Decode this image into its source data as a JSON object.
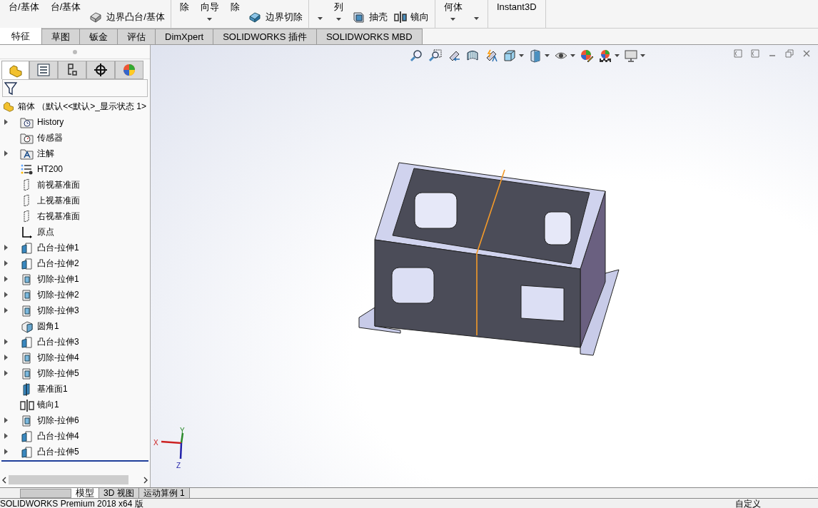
{
  "ribbon": {
    "groups": [
      {
        "items": [
          {
            "kind": "big",
            "label": "台/基体"
          },
          {
            "kind": "big",
            "label": "台/基体"
          },
          {
            "kind": "boss-tool",
            "label": "边界凸台/基体"
          }
        ]
      },
      {
        "items": [
          {
            "kind": "big",
            "label": "除"
          },
          {
            "kind": "bigcaret",
            "label": "向导"
          },
          {
            "kind": "big",
            "label": "除"
          },
          {
            "kind": "cut-tool",
            "label": "边界切除"
          }
        ]
      },
      {
        "items": [
          {
            "kind": "caret"
          },
          {
            "kind": "bigcaret",
            "label": "列"
          },
          {
            "kind": "shell-tool",
            "label": "抽壳"
          },
          {
            "kind": "mirror-tool",
            "label": "镜向"
          }
        ]
      },
      {
        "items": [
          {
            "kind": "bigcaret",
            "label": "何体"
          },
          {
            "kind": "caret"
          }
        ]
      },
      {
        "items": [
          {
            "kind": "big",
            "label": "Instant3D"
          }
        ]
      }
    ]
  },
  "tabs": [
    {
      "label": "特征",
      "selected": true
    },
    {
      "label": "草图",
      "selected": false
    },
    {
      "label": "钣金",
      "selected": false
    },
    {
      "label": "评估",
      "selected": false
    },
    {
      "label": "DimXpert",
      "selected": false
    },
    {
      "label": "SOLIDWORKS 插件",
      "selected": false
    },
    {
      "label": "SOLIDWORKS MBD",
      "selected": false
    }
  ],
  "panel_tabs": [
    {
      "kind": "feature",
      "selected": true
    },
    {
      "kind": "property",
      "selected": false
    },
    {
      "kind": "config",
      "selected": false
    },
    {
      "kind": "dimxpert",
      "selected": false
    },
    {
      "kind": "display",
      "selected": false
    }
  ],
  "tree": {
    "root": "箱体 （默认<<默认>_显示状态 1>",
    "items": [
      {
        "kind": "history",
        "label": "History",
        "expandable": true
      },
      {
        "kind": "sensor",
        "label": "传感器",
        "expandable": false
      },
      {
        "kind": "annotation",
        "label": "注解",
        "expandable": true
      },
      {
        "kind": "material",
        "label": "HT200",
        "expandable": false
      },
      {
        "kind": "plane",
        "label": "前视基准面",
        "expandable": false
      },
      {
        "kind": "plane",
        "label": "上视基准面",
        "expandable": false
      },
      {
        "kind": "plane",
        "label": "右视基准面",
        "expandable": false
      },
      {
        "kind": "origin",
        "label": "原点",
        "expandable": false
      },
      {
        "kind": "boss",
        "label": "凸台-拉伸1",
        "expandable": true
      },
      {
        "kind": "boss",
        "label": "凸台-拉伸2",
        "expandable": true
      },
      {
        "kind": "cut",
        "label": "切除-拉伸1",
        "expandable": true
      },
      {
        "kind": "cut",
        "label": "切除-拉伸2",
        "expandable": true
      },
      {
        "kind": "cut",
        "label": "切除-拉伸3",
        "expandable": true
      },
      {
        "kind": "fillet",
        "label": "圆角1",
        "expandable": false
      },
      {
        "kind": "boss",
        "label": "凸台-拉伸3",
        "expandable": true
      },
      {
        "kind": "cut",
        "label": "切除-拉伸4",
        "expandable": true
      },
      {
        "kind": "cut",
        "label": "切除-拉伸5",
        "expandable": true
      },
      {
        "kind": "refplane",
        "label": "基准面1",
        "expandable": false
      },
      {
        "kind": "mirror",
        "label": "镜向1",
        "expandable": false
      },
      {
        "kind": "cut",
        "label": "切除-拉伸6",
        "expandable": true
      },
      {
        "kind": "boss",
        "label": "凸台-拉伸4",
        "expandable": true
      },
      {
        "kind": "boss",
        "label": "凸台-拉伸5",
        "expandable": true
      }
    ]
  },
  "view_toolbar": [
    {
      "kind": "zoom-fit",
      "caret": false
    },
    {
      "kind": "zoom-area",
      "caret": false
    },
    {
      "kind": "previous",
      "caret": false
    },
    {
      "kind": "section",
      "caret": false
    },
    {
      "kind": "dynamic",
      "caret": false
    },
    {
      "kind": "orientation",
      "caret": true
    },
    {
      "kind": "display-style",
      "caret": true
    },
    {
      "kind": "hide-show",
      "caret": true
    },
    {
      "kind": "edit-appearance",
      "caret": false
    },
    {
      "kind": "scene",
      "caret": true
    },
    {
      "kind": "view-settings",
      "caret": true
    }
  ],
  "triad": {
    "x": "X",
    "y": "Y",
    "z": "Z"
  },
  "bottom_tabs": [
    {
      "label": "模型",
      "selected": true
    },
    {
      "label": "3D 视图",
      "selected": false
    },
    {
      "label": "运动算例 1",
      "selected": false
    }
  ],
  "status_bar": {
    "product": "SOLIDWORKS Premium 2018 x64 版",
    "units": "自定义"
  }
}
